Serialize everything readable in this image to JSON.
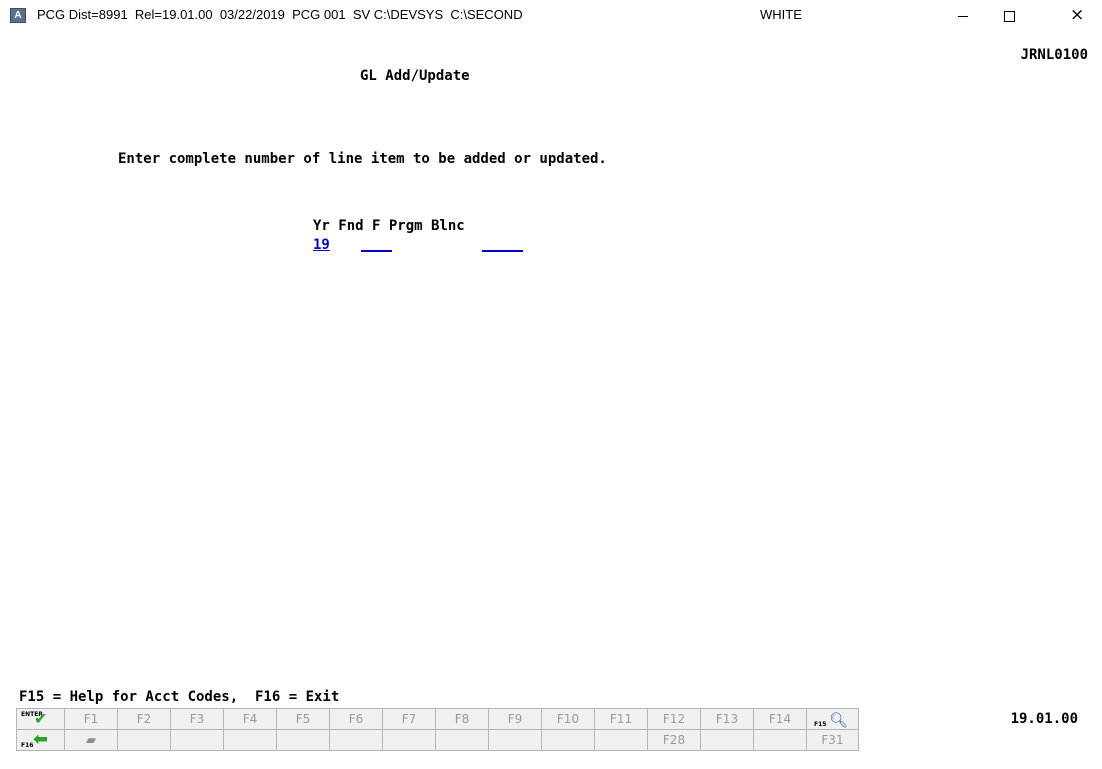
{
  "window": {
    "app_icon": "A",
    "title": "PCG Dist=8991  Rel=19.01.00  03/22/2019  PCG 001  SV C:\\DEVSYS  C:\\SECOND",
    "title_extra": "WHITE",
    "close_glyph": "×"
  },
  "screen": {
    "id": "JRNL0100",
    "title": "GL Add/Update",
    "prompt": "Enter complete number of line item to be added or updated.",
    "column_headers": "Yr Fnd F Prgm Blnc",
    "fields": {
      "yr_value": "19"
    },
    "help_line": "F15 = Help for Acct Codes,  F16 = Exit",
    "version": "19.01.00"
  },
  "fkeys": {
    "row1": [
      "F1",
      "F2",
      "F3",
      "F4",
      "F5",
      "F6",
      "F7",
      "F8",
      "F9",
      "F10",
      "F11",
      "F12",
      "F13",
      "F14"
    ],
    "row2": [
      "",
      "",
      "",
      "",
      "",
      "",
      "",
      "",
      "",
      "",
      "F28",
      "",
      "F31"
    ],
    "enter_label": "ENTER",
    "f15_label": "F15",
    "f16_label": "F16"
  }
}
